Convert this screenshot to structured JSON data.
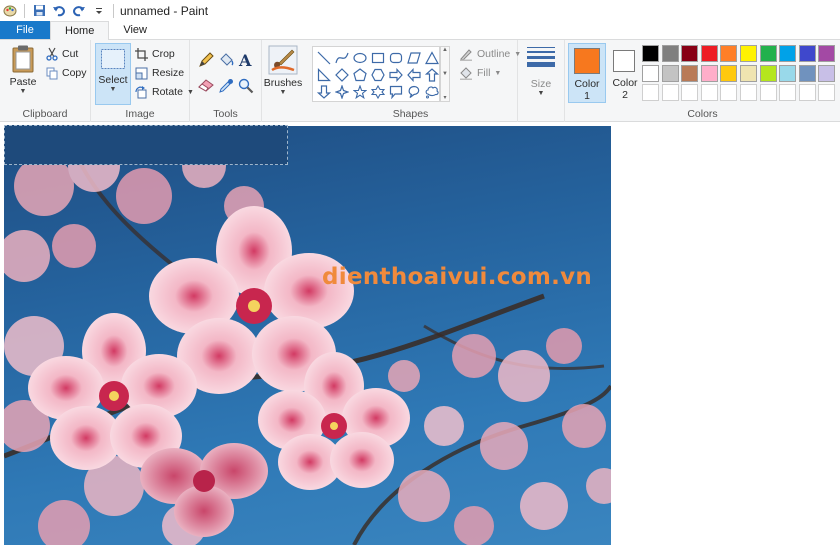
{
  "window": {
    "title": "unnamed - Paint"
  },
  "quick_access": {
    "icons": [
      "paint-app-icon",
      "save-icon",
      "undo-icon",
      "redo-icon",
      "customize-qat-icon"
    ]
  },
  "tabs": [
    {
      "label": "File"
    },
    {
      "label": "Home"
    },
    {
      "label": "View"
    }
  ],
  "ribbon": {
    "clipboard": {
      "label": "Clipboard",
      "paste": "Paste",
      "cut": "Cut",
      "copy": "Copy"
    },
    "image": {
      "label": "Image",
      "select": "Select",
      "crop": "Crop",
      "resize": "Resize",
      "rotate": "Rotate"
    },
    "tools": {
      "label": "Tools"
    },
    "brushes": {
      "label": "Brushes"
    },
    "shapes": {
      "label": "Shapes",
      "outline": "Outline",
      "fill": "Fill"
    },
    "size": {
      "label": "Size"
    },
    "colors": {
      "label": "Colors",
      "color1": "Color",
      "color1_num": "1",
      "color2": "Color",
      "color2_num": "2",
      "color1_value": "#f7781e",
      "color2_value": "#ffffff",
      "palette_row1": [
        "#000000",
        "#7f7f7f",
        "#880015",
        "#ed1c24",
        "#ff7f27",
        "#fff200",
        "#22b14c",
        "#00a2e8",
        "#3f48cc",
        "#a349a4"
      ],
      "palette_row2": [
        "#ffffff",
        "#c3c3c3",
        "#b97a57",
        "#ffaec9",
        "#ffc90e",
        "#efe4b0",
        "#b5e61d",
        "#99d9ea",
        "#7092be",
        "#c8bfe7"
      ],
      "palette_row3": [
        "#ffffff",
        "#ffffff",
        "#ffffff",
        "#ffffff",
        "#ffffff",
        "#ffffff",
        "#ffffff",
        "#ffffff",
        "#ffffff",
        "#ffffff"
      ]
    }
  },
  "canvas": {
    "watermark": "dienthoaivui.com.vn"
  }
}
